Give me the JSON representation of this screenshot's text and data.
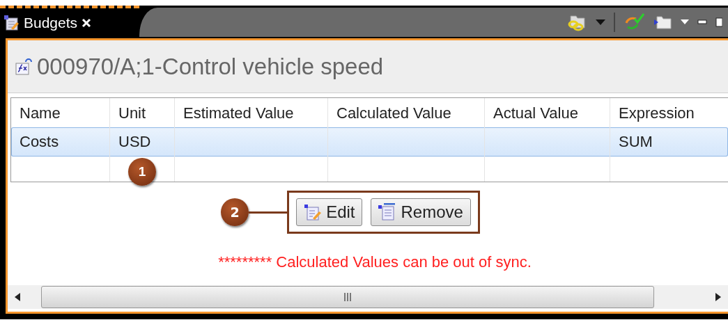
{
  "tab": {
    "title": "Budgets"
  },
  "header": {
    "title": "000970/A;1-Control vehicle speed"
  },
  "table": {
    "columns": [
      "Name",
      "Unit",
      "Estimated Value",
      "Calculated Value",
      "Actual Value",
      "Expression"
    ],
    "rows": [
      {
        "cells": [
          "Costs",
          "USD",
          null,
          null,
          null,
          "SUM"
        ],
        "selected": true
      }
    ]
  },
  "callouts": [
    {
      "number": "1"
    },
    {
      "number": "2"
    }
  ],
  "buttons": [
    {
      "label": "Edit",
      "kind": "edit"
    },
    {
      "label": "Remove",
      "kind": "remove"
    }
  ],
  "warning": "********* Calculated Values can be out of sync."
}
